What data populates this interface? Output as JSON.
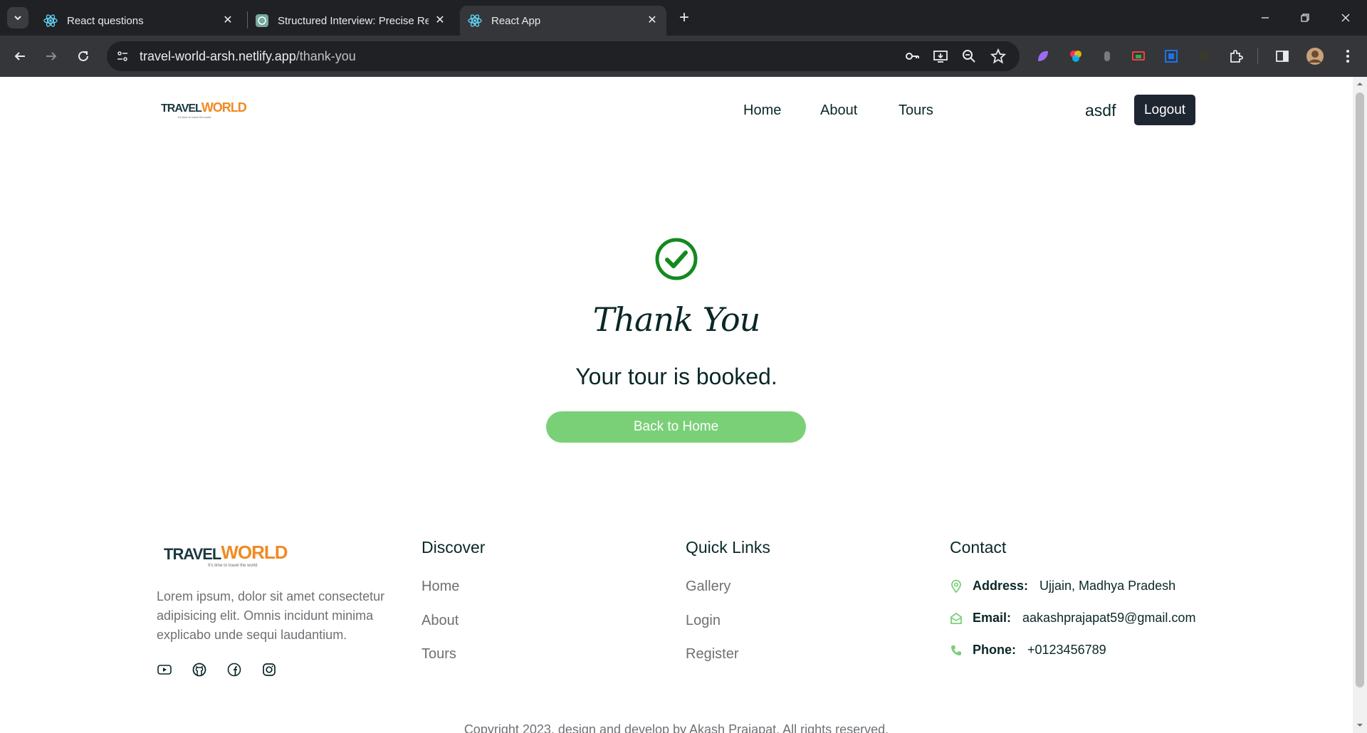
{
  "browser": {
    "tabs": [
      {
        "title": "React questions",
        "icon": "react-icon",
        "active": false
      },
      {
        "title": "Structured Interview: Precise Re",
        "icon": "chatgpt-icon",
        "active": false
      },
      {
        "title": "React App",
        "icon": "react-icon",
        "active": true
      }
    ],
    "new_tab_label": "+",
    "url_host": "travel-world-arsh.netlify.app",
    "url_path": "/thank-you"
  },
  "colors": {
    "brand_orange": "#f08a24",
    "dark": "#0b2727",
    "success_green": "#138a1e",
    "button_green": "#7ad077",
    "logout_bg": "#1e2631"
  },
  "logo": {
    "word1": "TRAVEL",
    "word2": "WORLD",
    "tagline": "It's time to travel the world"
  },
  "nav": {
    "items": [
      "Home",
      "About",
      "Tours"
    ],
    "username": "asdf",
    "logout_label": "Logout"
  },
  "main": {
    "icon": "check-circle-icon",
    "heading": "Thank You",
    "message": "Your tour is booked.",
    "button_label": "Back to Home"
  },
  "footer": {
    "description": "Lorem ipsum, dolor sit amet consectetur adipisicing elit. Omnis incidunt minima explicabo unde sequi laudantium.",
    "social_icons": [
      "youtube-icon",
      "github-icon",
      "facebook-icon",
      "instagram-icon"
    ],
    "discover": {
      "title": "Discover",
      "links": [
        "Home",
        "About",
        "Tours"
      ]
    },
    "quick_links": {
      "title": "Quick Links",
      "links": [
        "Gallery",
        "Login",
        "Register"
      ]
    },
    "contact": {
      "title": "Contact",
      "address_label": "Address:",
      "address": "Ujjain, Madhya Pradesh",
      "email_label": "Email:",
      "email": "aakashprajapat59@gmail.com",
      "phone_label": "Phone:",
      "phone": "+0123456789"
    },
    "copyright": "Copyright 2023, design and develop by Akash Prajapat. All rights reserved."
  }
}
